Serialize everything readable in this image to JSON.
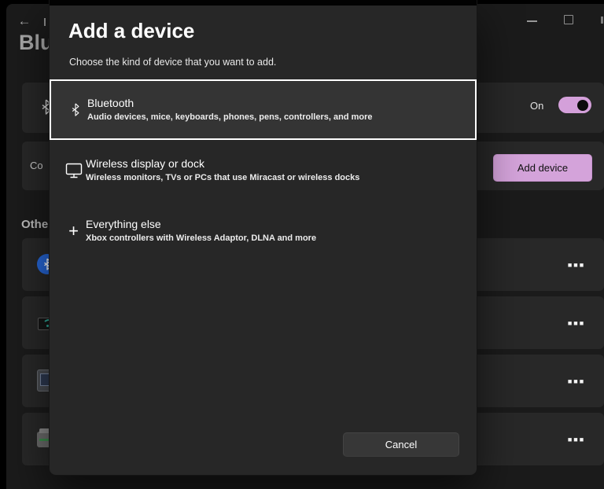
{
  "colors": {
    "accent_pink": "#d4a0da",
    "dialog_bg": "#272727",
    "selected_row_bg": "#343434",
    "page_bg": "#1b1b1b",
    "card_bg": "#282828",
    "bluetooth_blue": "#2667d9"
  },
  "titlebar": {
    "back_icon": "←"
  },
  "background": {
    "page_title_partial": "Blu",
    "bluetooth_row": {
      "toggle_label": "On",
      "toggle_state": "on"
    },
    "connect_row": {
      "label_partial": "Co",
      "add_device_button": "Add device"
    },
    "section_heading_partial": "Othe",
    "row_menu_glyph": "■■■",
    "other_rows": [
      {
        "icon": "bluetooth-device-icon"
      },
      {
        "icon": "wireless-display-device-icon"
      },
      {
        "icon": "media-device-icon"
      },
      {
        "icon": "printer-device-icon"
      }
    ]
  },
  "dialog": {
    "title": "Add a device",
    "subtitle": "Choose the kind of device that you want to add.",
    "options": [
      {
        "title": "Bluetooth",
        "description": "Audio devices, mice, keyboards, phones, pens, controllers, and more",
        "icon": "bluetooth-icon",
        "selected": true
      },
      {
        "title": "Wireless display or dock",
        "description": "Wireless monitors, TVs or PCs that use Miracast or wireless docks",
        "icon": "wireless-display-icon",
        "selected": false
      },
      {
        "title": "Everything else",
        "description": "Xbox controllers with Wireless Adaptor, DLNA and more",
        "icon": "plus-icon",
        "selected": false
      }
    ],
    "cancel_label": "Cancel",
    "plus_glyph": "+"
  }
}
